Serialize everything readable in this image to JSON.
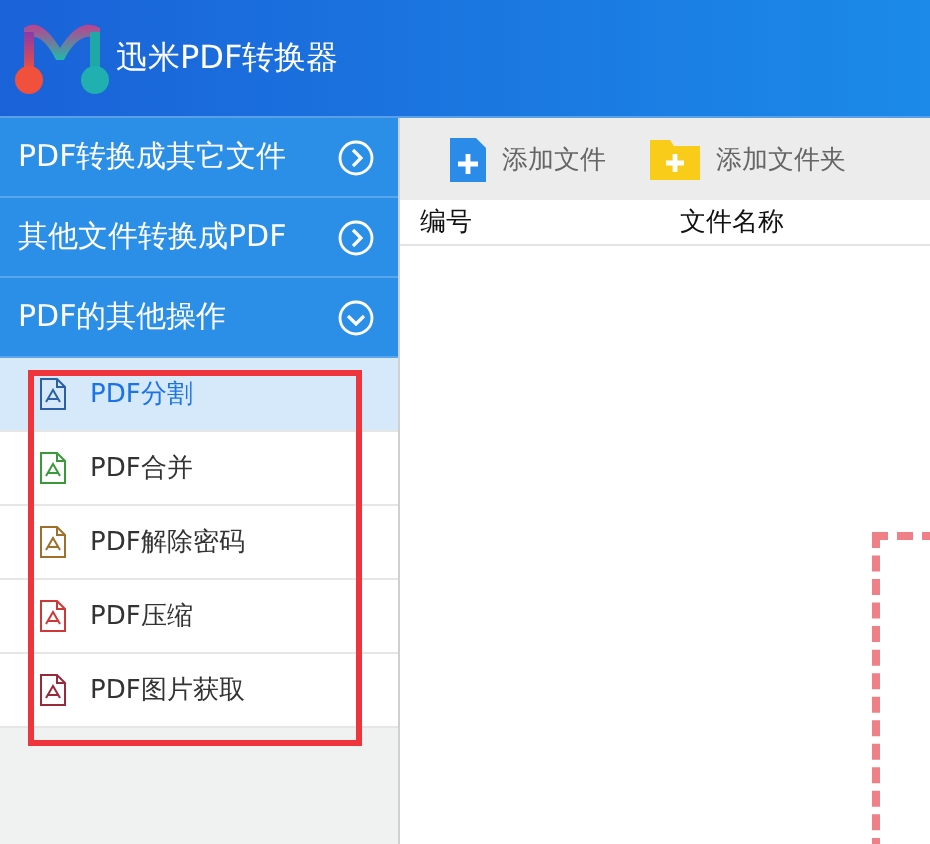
{
  "window": {
    "title": "迅米PDF转换器"
  },
  "sidebar": {
    "categories": [
      {
        "label": "PDF转换成其它文件",
        "expanded": false
      },
      {
        "label": "其他文件转换成PDF",
        "expanded": false
      },
      {
        "label": "PDF的其他操作",
        "expanded": true,
        "items": [
          {
            "label": "PDF分割",
            "selected": true,
            "color": "#2b5fa8"
          },
          {
            "label": "PDF合并",
            "selected": false,
            "color": "#3a9a3a"
          },
          {
            "label": "PDF解除密码",
            "selected": false,
            "color": "#a0702a"
          },
          {
            "label": "PDF压缩",
            "selected": false,
            "color": "#d03838"
          },
          {
            "label": "PDF图片获取",
            "selected": false,
            "color": "#9a2a3a"
          }
        ]
      }
    ]
  },
  "toolbar": [
    {
      "kind": "file",
      "label": "添加文件"
    },
    {
      "kind": "folder",
      "label": "添加文件夹"
    }
  ],
  "table": {
    "columns": [
      "编号",
      "文件名称"
    ]
  }
}
